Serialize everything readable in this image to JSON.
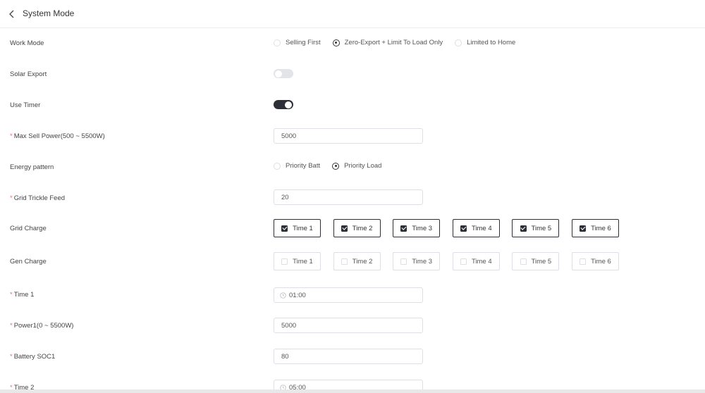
{
  "header": {
    "title": "System Mode"
  },
  "work_mode": {
    "label": "Work Mode",
    "options": [
      "Selling First",
      "Zero-Export + Limit To Load Only",
      "Limited to Home"
    ],
    "selected_index": 1
  },
  "solar_export": {
    "label": "Solar Export",
    "enabled": false
  },
  "use_timer": {
    "label": "Use Timer",
    "enabled": true
  },
  "max_sell_power": {
    "label": "Max Sell Power(500 ~ 5500W)",
    "required": true,
    "value": "5000"
  },
  "energy_pattern": {
    "label": "Energy pattern",
    "options": [
      "Priority Batt",
      "Priority Load"
    ],
    "selected_index": 1
  },
  "grid_trickle_feed": {
    "label": "Grid Trickle Feed",
    "required": true,
    "value": "20"
  },
  "grid_charge": {
    "label": "Grid Charge",
    "items": [
      {
        "label": "Time 1",
        "checked": true
      },
      {
        "label": "Time 2",
        "checked": true
      },
      {
        "label": "Time 3",
        "checked": true
      },
      {
        "label": "Time 4",
        "checked": true
      },
      {
        "label": "Time 5",
        "checked": true
      },
      {
        "label": "Time 6",
        "checked": true
      }
    ]
  },
  "gen_charge": {
    "label": "Gen Charge",
    "items": [
      {
        "label": "Time 1",
        "checked": false
      },
      {
        "label": "Time 2",
        "checked": false
      },
      {
        "label": "Time 3",
        "checked": false
      },
      {
        "label": "Time 4",
        "checked": false
      },
      {
        "label": "Time 5",
        "checked": false
      },
      {
        "label": "Time 6",
        "checked": false
      }
    ]
  },
  "time1": {
    "label": "Time 1",
    "required": true,
    "value": "01:00"
  },
  "power1": {
    "label": "Power1(0 ~ 5500W)",
    "required": true,
    "value": "5000"
  },
  "battery_soc1": {
    "label": "Battery SOC1",
    "required": true,
    "value": "80"
  },
  "time2": {
    "label": "Time 2",
    "required": true,
    "value": "05:00"
  },
  "icons": {
    "back": "chevron-left-icon",
    "clock": "clock-icon",
    "checkbox": "checkbox-icon"
  },
  "colors": {
    "accent": "#2d2f36",
    "required": "#f56c6c",
    "border": "#dcdfe6",
    "switch_off": "#e2e4e8"
  }
}
